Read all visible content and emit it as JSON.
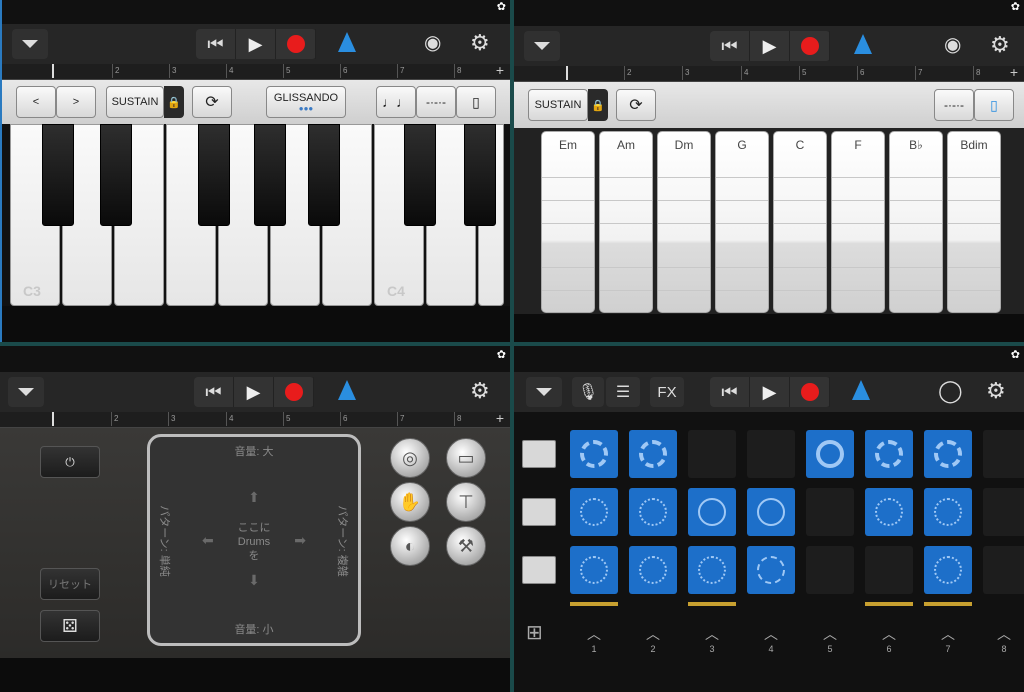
{
  "keyboard": {
    "ruler_ticks": [
      "2",
      "3",
      "4",
      "5",
      "6",
      "7",
      "8"
    ],
    "buttons": {
      "prev": "<",
      "next": ">",
      "sustain": "SUSTAIN",
      "glissando": "GLISSANDO"
    },
    "octave_labels": [
      "C3",
      "C4"
    ]
  },
  "smart_keys": {
    "ruler_ticks": [
      "2",
      "3",
      "4",
      "5",
      "6",
      "7",
      "8"
    ],
    "sustain": "SUSTAIN",
    "chords": [
      "Em",
      "Am",
      "Dm",
      "G",
      "C",
      "F",
      "B♭",
      "Bdim"
    ]
  },
  "drums": {
    "ruler_ticks": [
      "2",
      "3",
      "4",
      "5",
      "6",
      "7",
      "8"
    ],
    "reset_label": "リセット",
    "pad_top": "音量: 大",
    "pad_bottom": "音量: 小",
    "pad_left": "パターン: 単純",
    "pad_right": "パターン: 複雑",
    "pad_center": "ここに\nDrums\nを"
  },
  "live_loops": {
    "fx_label": "FX",
    "columns": [
      "1",
      "2",
      "3",
      "4",
      "5",
      "6",
      "7",
      "8"
    ]
  },
  "colors": {
    "record": "#e81c1c",
    "metronome": "#2a8ee0",
    "loop_cell": "#1d6fc9"
  },
  "icons": [
    "menu-triangle-icon",
    "rewind-icon",
    "play-icon",
    "record-icon",
    "metronome-icon",
    "gear-icon",
    "tuner-icon",
    "mic-icon",
    "tracks-icon",
    "loop-browser-icon",
    "edit-grid-icon"
  ]
}
